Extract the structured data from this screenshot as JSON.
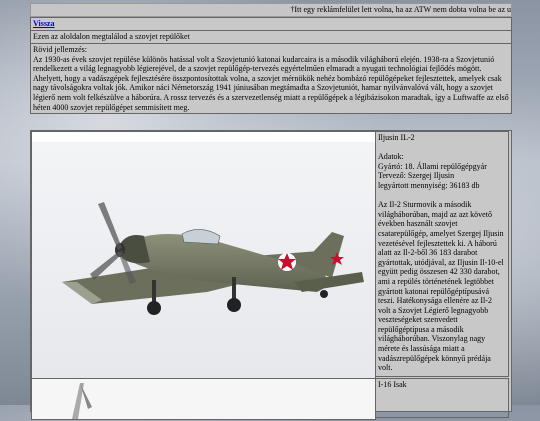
{
  "ticker": {
    "text": "†Itt egy reklámfelület lett volna, ha az ATW nem dobta volna be az u"
  },
  "header": {
    "back_link": "Vissza",
    "subtitle": "Ezen az aloldalon megtalálod a szovjet repülőket",
    "desc_title": "Rövid jellemzés:",
    "desc_text": "Az 1930-as évek szovjet repülése különös hatással volt a Szovjetunió katonai kudarcaira is a második világháború elején. 1938-ra a Szovjetunió rendelkezett a világ legnagyobb légierejével, de a szovjet repülőgép-tervezés egyértelműen elmaradt a nyugati technológiai fejlődés mögött. Ahelyett, hogy a vadászgépek fejlesztésére összpontosítottak volna, a szovjet mérnökök nehéz bombázó repülőgépeket fejlesztettek, amelyek csak nagy távolságokra voltak jók. Amikor náci Németország 1941 júniusában megtámadta a Szovjetuniót, hamar nyilvánvalóvá vált, hogy a szovjet légierő nem volt felkészülve a háborúra. A rossz tervezés és a szervezetlenség miatt a repülőgépek a légibázisokon maradtak, így a Luftwaffe az első héten 4000 szovjet repülőgépet semmisített meg."
  },
  "planes": [
    {
      "name": "Iljusin IL-2",
      "data_title": "Adatok:",
      "maker": "Gyártó: 18. Állami repülőgépgyár",
      "designer": "Tervező: Szergej Iljusin",
      "count": "legyártott mennyiség: 36183 db",
      "text": "Az Il-2 Sturmovik a második világháborúban, majd az azt követő években használt szovjet csatarepülőgép, amelyet Szergej Iljusin vezetésével fejlesztettek ki. A háború alatt az Il-2-ből 36 183 darabot gyártottak, utódjával, az Iljusin Il-10-el együtt pedig összesen 42 330 darabot, ami a repülés történetének legtöbbet gyártott katonai repülőgéptípusává teszi. Hatékonysága ellenére az Il-2 volt a Szovjet Légierő legnagyobb veszteségeket szenvedett repülőgéptípusa a második világháborúban. Viszonylag nagy mérete és lassúsága miatt a vadászrepülőgépek könnyű prédája volt.",
      "roundel_color": "#c8102e"
    },
    {
      "name": "I-16 Isak"
    }
  ]
}
